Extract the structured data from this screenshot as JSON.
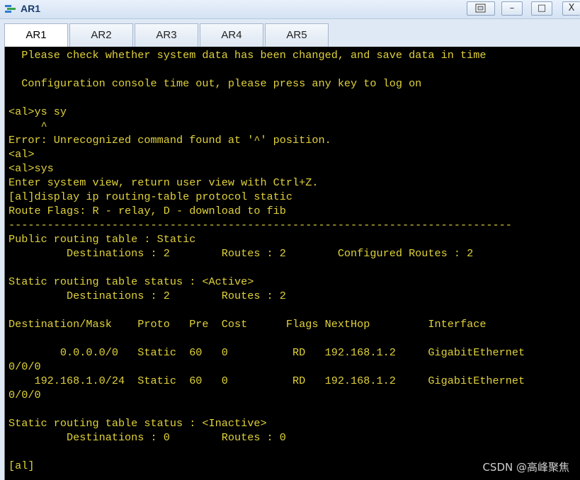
{
  "window": {
    "title": "AR1",
    "controls": {
      "restore_icon": "restore-icon",
      "minimize": "–",
      "maximize": "□",
      "close": "X"
    }
  },
  "tabs": [
    {
      "label": "AR1",
      "active": true
    },
    {
      "label": "AR2",
      "active": false
    },
    {
      "label": "AR3",
      "active": false
    },
    {
      "label": "AR4",
      "active": false
    },
    {
      "label": "AR5",
      "active": false
    }
  ],
  "terminal": {
    "text_color": "#e0d23a",
    "background": "#000000",
    "lines": [
      "  Please check whether system data has been changed, and save data in time",
      "",
      "  Configuration console time out, please press any key to log on",
      "",
      "<al>ys sy",
      "     ^",
      "Error: Unrecognized command found at '^' position.",
      "<al>",
      "<al>sys",
      "Enter system view, return user view with Ctrl+Z.",
      "[al]display ip routing-table protocol static",
      "Route Flags: R - relay, D - download to fib",
      "------------------------------------------------------------------------------",
      "Public routing table : Static",
      "         Destinations : 2        Routes : 2        Configured Routes : 2",
      "",
      "Static routing table status : <Active>",
      "         Destinations : 2        Routes : 2",
      "",
      "Destination/Mask    Proto   Pre  Cost      Flags NextHop         Interface",
      "",
      "        0.0.0.0/0   Static  60   0          RD   192.168.1.2     GigabitEthernet",
      "0/0/0",
      "    192.168.1.0/24  Static  60   0          RD   192.168.1.2     GigabitEthernet",
      "0/0/0",
      "",
      "Static routing table status : <Inactive>",
      "         Destinations : 0        Routes : 0",
      "",
      "[al]"
    ]
  },
  "watermark": "CSDN @高峰聚焦"
}
